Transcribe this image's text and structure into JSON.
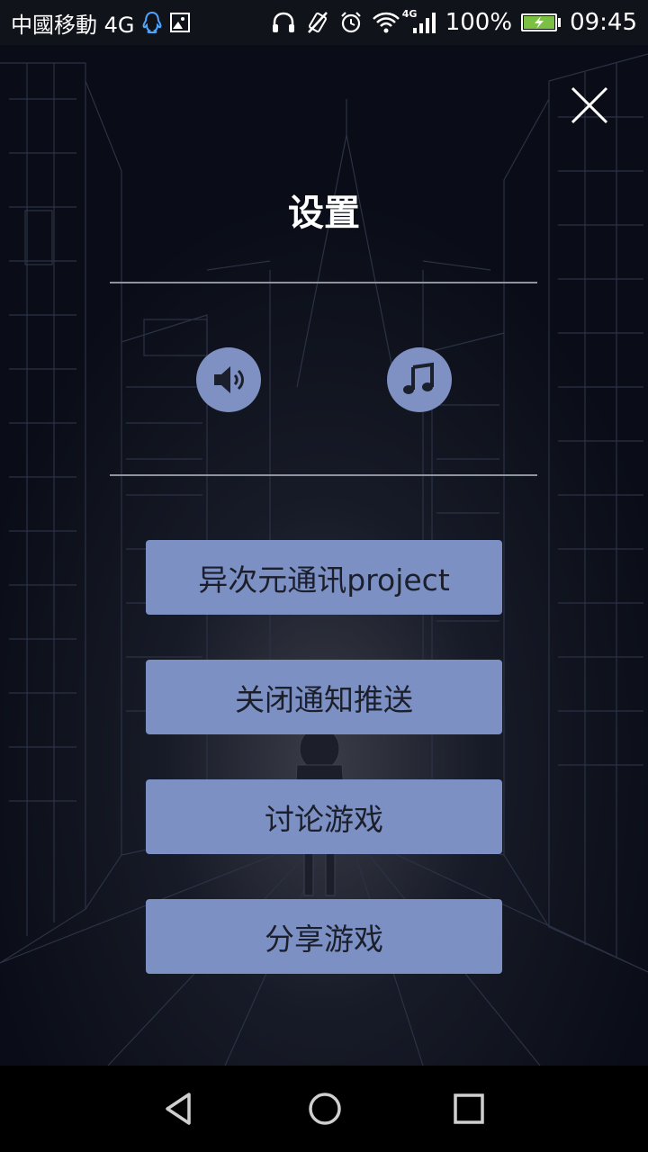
{
  "status_bar": {
    "carrier": "中國移動 4G",
    "network_badge": "4G",
    "battery_percent": "100%",
    "battery_level": 1.0,
    "time": "09:45",
    "icons": [
      "qq-icon",
      "image-icon",
      "headphones-icon",
      "vibrate-off-icon",
      "alarm-icon",
      "wifi-icon",
      "cell-signal-icon",
      "battery-charging-icon"
    ]
  },
  "settings": {
    "title": "设置",
    "close_icon": "close-icon",
    "sound_icon": "speaker-icon",
    "music_icon": "music-note-icon",
    "buttons": [
      {
        "label": "异次元通讯project"
      },
      {
        "label": "关闭通知推送"
      },
      {
        "label": "讨论游戏"
      },
      {
        "label": "分享游戏"
      }
    ]
  },
  "nav_bar": {
    "icons": [
      "back-icon",
      "home-icon",
      "recents-icon"
    ]
  },
  "colors": {
    "button_bg": "#7d90c4",
    "button_text": "#1b1f2b",
    "background": "#0b0f1a",
    "divider": "#8e93a0"
  }
}
